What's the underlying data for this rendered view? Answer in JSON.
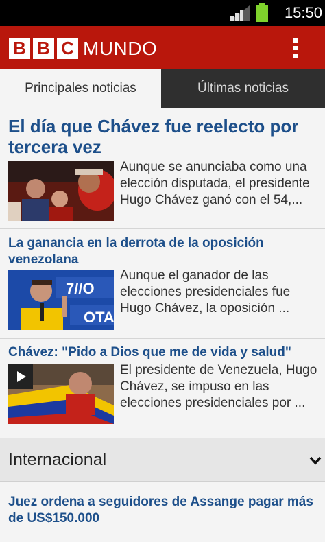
{
  "status_bar": {
    "time": "15:50"
  },
  "header": {
    "logo_letters": [
      "B",
      "B",
      "C"
    ],
    "logo_word": "MUNDO"
  },
  "tabs": [
    {
      "label": "Principales noticias",
      "active": true
    },
    {
      "label": "Últimas noticias",
      "active": false
    }
  ],
  "top_story": {
    "title": "El día que Chávez fue reelecto por tercera vez",
    "summary": "Aunque se anunciaba como una elección disputada, el presidente Hugo Chávez ganó con el 54,..."
  },
  "articles": [
    {
      "title": "La ganancia en la derrota de la oposición venezolana",
      "summary": "Aunque el ganador de las elecciones presidenciales fue Hugo Chávez, la oposición ..."
    },
    {
      "title": "Chávez: \"Pido a Dios que me de vida y salud\"",
      "summary": "El presidente de Venezuela, Hugo Chávez, se impuso en las elecciones presidenciales por ..."
    }
  ],
  "section": {
    "title": "Internacional"
  },
  "section_story": {
    "title": "Juez ordena a seguidores de Assange pagar más de US$150.000"
  },
  "colors": {
    "brand_red": "#b9170c",
    "headline_blue": "#1d4f8a",
    "battery_green": "#7fd22c"
  },
  "icons": {
    "signal": "signal-icon",
    "battery": "battery-icon",
    "menu": "overflow-menu-icon",
    "play": "play-icon",
    "chevron": "chevron-down-icon"
  }
}
